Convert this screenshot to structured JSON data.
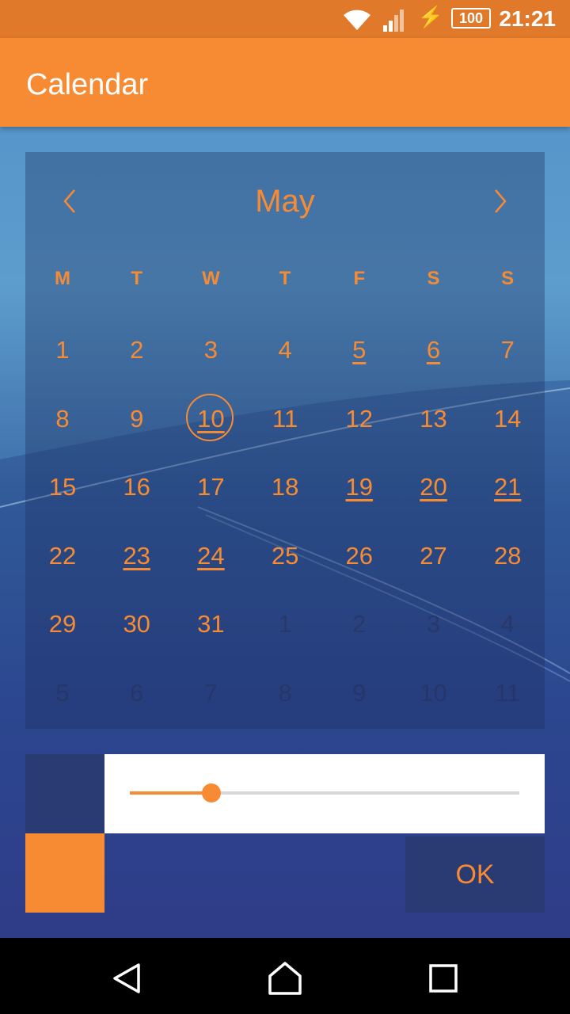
{
  "status_bar": {
    "time": "21:21",
    "battery": "100",
    "icons": [
      "wifi-icon",
      "signal-icon",
      "charging-icon",
      "battery-icon"
    ]
  },
  "app_bar": {
    "title": "Calendar"
  },
  "calendar": {
    "month": "May",
    "weekdays": [
      "M",
      "T",
      "W",
      "T",
      "F",
      "S",
      "S"
    ],
    "weeks": [
      [
        {
          "d": "1"
        },
        {
          "d": "2"
        },
        {
          "d": "3"
        },
        {
          "d": "4"
        },
        {
          "d": "5",
          "event": true
        },
        {
          "d": "6",
          "event": true
        },
        {
          "d": "7"
        }
      ],
      [
        {
          "d": "8"
        },
        {
          "d": "9"
        },
        {
          "d": "10",
          "today": true,
          "event": true
        },
        {
          "d": "11"
        },
        {
          "d": "12"
        },
        {
          "d": "13"
        },
        {
          "d": "14"
        }
      ],
      [
        {
          "d": "15"
        },
        {
          "d": "16"
        },
        {
          "d": "17"
        },
        {
          "d": "18"
        },
        {
          "d": "19",
          "event": true
        },
        {
          "d": "20",
          "event": true
        },
        {
          "d": "21",
          "event": true
        }
      ],
      [
        {
          "d": "22"
        },
        {
          "d": "23",
          "event": true
        },
        {
          "d": "24",
          "event": true
        },
        {
          "d": "25"
        },
        {
          "d": "26"
        },
        {
          "d": "27"
        },
        {
          "d": "28"
        }
      ],
      [
        {
          "d": "29"
        },
        {
          "d": "30"
        },
        {
          "d": "31"
        },
        {
          "d": "1",
          "other": true
        },
        {
          "d": "2",
          "other": true
        },
        {
          "d": "3",
          "other": true
        },
        {
          "d": "4",
          "other": true
        }
      ],
      [
        {
          "d": "5",
          "other": true
        },
        {
          "d": "6",
          "other": true
        },
        {
          "d": "7",
          "other": true
        },
        {
          "d": "8",
          "other": true
        },
        {
          "d": "9",
          "other": true
        },
        {
          "d": "10",
          "other": true
        },
        {
          "d": "11",
          "other": true
        }
      ]
    ]
  },
  "slider": {
    "value_fraction": 0.21
  },
  "ok_button": {
    "label": "OK"
  },
  "colors": {
    "accent": "#f68b33",
    "status_bar": "#e07a2a",
    "dark_panel": "#2a3a72"
  },
  "navigation": {
    "icons": [
      "back-icon",
      "home-icon",
      "recents-icon"
    ]
  }
}
